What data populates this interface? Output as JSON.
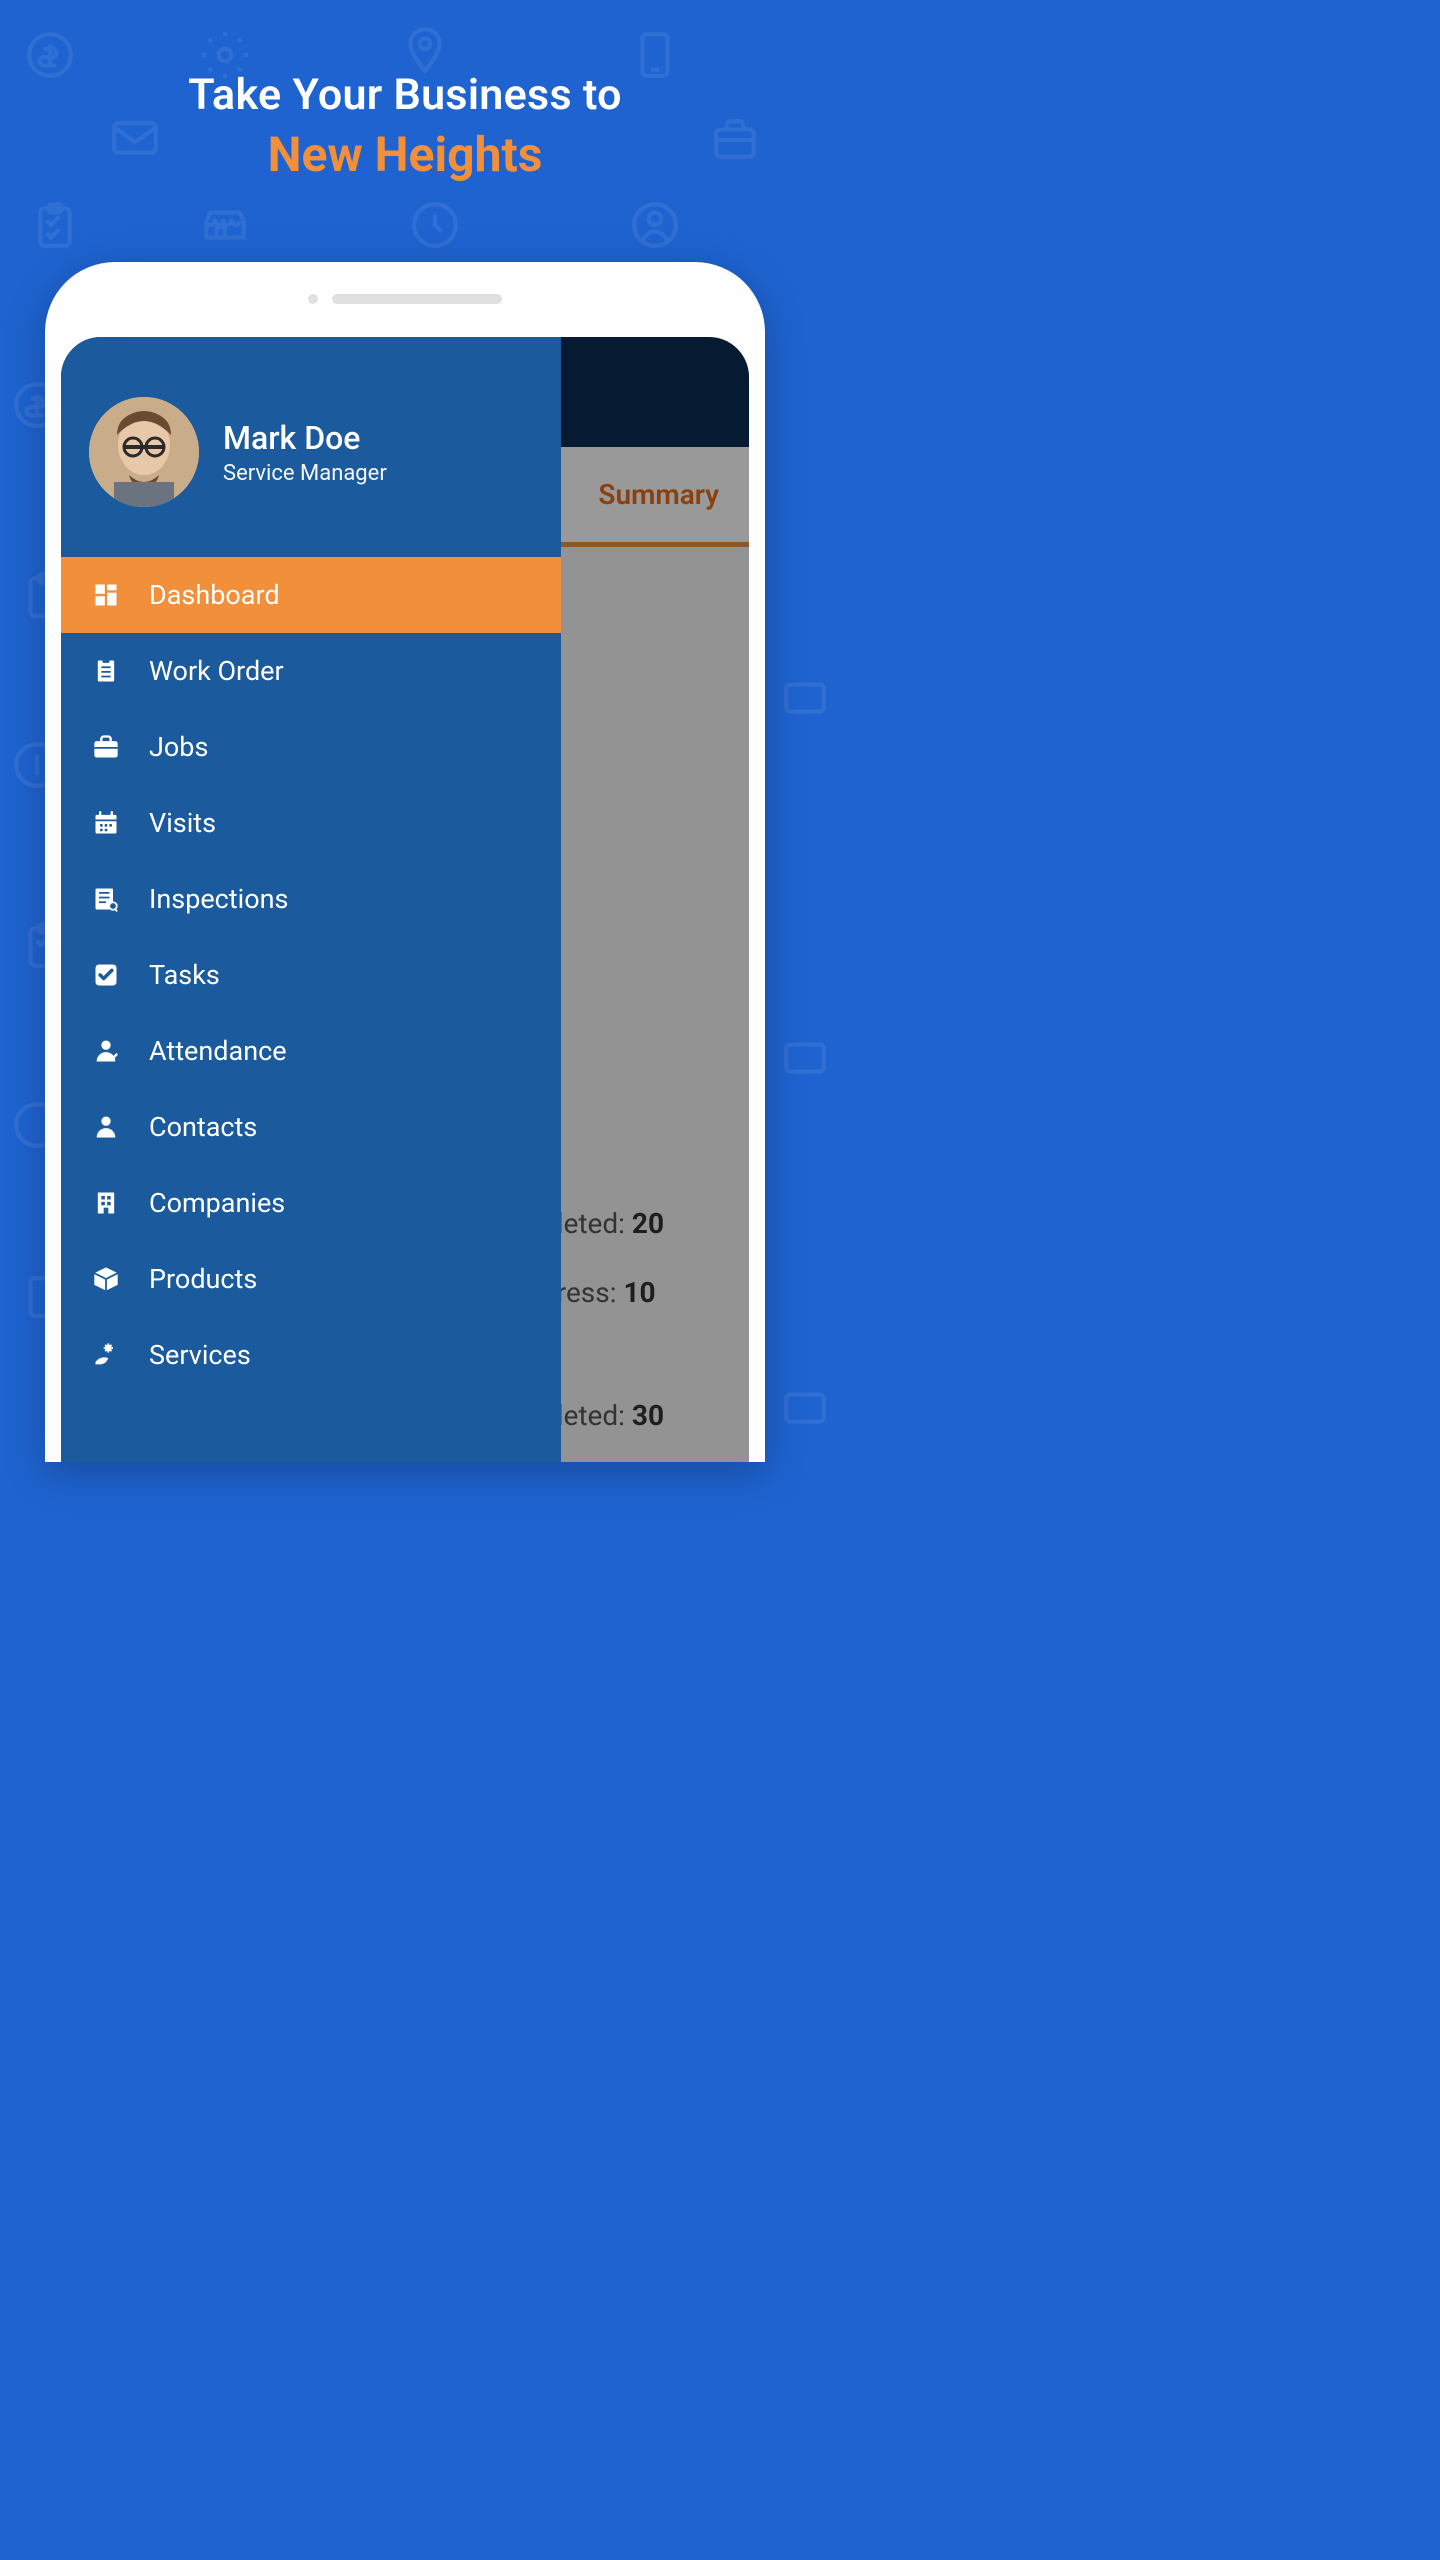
{
  "tagline": {
    "line1": "Take Your Business to",
    "line2": "New Heights"
  },
  "user": {
    "name": "Mark Doe",
    "role": "Service Manager"
  },
  "nav": {
    "items": [
      {
        "label": "Dashboard",
        "active": true
      },
      {
        "label": "Work Order",
        "active": false
      },
      {
        "label": "Jobs",
        "active": false
      },
      {
        "label": "Visits",
        "active": false
      },
      {
        "label": "Inspections",
        "active": false
      },
      {
        "label": "Tasks",
        "active": false
      },
      {
        "label": "Attendance",
        "active": false
      },
      {
        "label": "Contacts",
        "active": false
      },
      {
        "label": "Companies",
        "active": false
      },
      {
        "label": "Products",
        "active": false
      },
      {
        "label": "Services",
        "active": false
      }
    ]
  },
  "screen": {
    "tab": "Summary",
    "stats": [
      {
        "label": "pleted:",
        "value": "20"
      },
      {
        "label": "gress:",
        "value": "10"
      },
      {
        "label": "pleted:",
        "value": "30"
      }
    ]
  },
  "colors": {
    "background": "#1e63d0",
    "drawer": "#1b5a9c",
    "accent": "#f18f3b",
    "topbar": "#0b2c54"
  }
}
